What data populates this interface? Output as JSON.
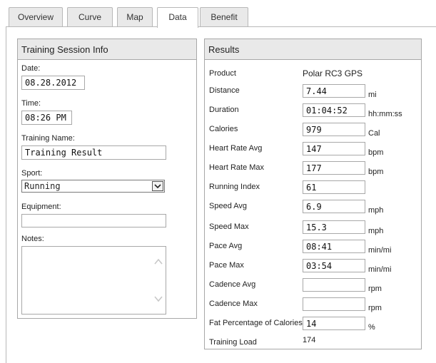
{
  "tabs": [
    {
      "label": "Overview",
      "active": false
    },
    {
      "label": "Curve",
      "active": false
    },
    {
      "label": "Map",
      "active": false
    },
    {
      "label": "Data",
      "active": true
    },
    {
      "label": "Benefit",
      "active": false
    }
  ],
  "session_info": {
    "title": "Training Session Info",
    "date_label": "Date:",
    "date_value": "08.28.2012",
    "time_label": "Time:",
    "time_value": "08:26 PM",
    "training_name_label": "Training Name:",
    "training_name_value": "Training Result",
    "sport_label": "Sport:",
    "sport_value": "Running",
    "equipment_label": "Equipment:",
    "equipment_value": "",
    "notes_label": "Notes:",
    "notes_value": ""
  },
  "results": {
    "title": "Results",
    "product_label": "Product",
    "product_value": "Polar RC3 GPS",
    "rows": [
      {
        "label": "Distance",
        "value": "7.44",
        "unit": "mi"
      },
      {
        "label": "Duration",
        "value": "01:04:52",
        "unit": "hh:mm:ss"
      },
      {
        "label": "Calories",
        "value": "979",
        "unit": "Cal"
      },
      {
        "label": "Heart Rate Avg",
        "value": "147",
        "unit": "bpm"
      },
      {
        "label": "Heart Rate Max",
        "value": "177",
        "unit": "bpm"
      },
      {
        "label": "Running Index",
        "value": "61",
        "unit": ""
      },
      {
        "label": "Speed Avg",
        "value": "6.9",
        "unit": "mph"
      },
      {
        "label": "Speed Max",
        "value": "15.3",
        "unit": "mph"
      },
      {
        "label": "Pace Avg",
        "value": "08:41",
        "unit": "min/mi"
      },
      {
        "label": "Pace Max",
        "value": "03:54",
        "unit": "min/mi"
      },
      {
        "label": "Cadence Avg",
        "value": "",
        "unit": "rpm"
      },
      {
        "label": "Cadence Max",
        "value": "",
        "unit": "rpm"
      },
      {
        "label": "Fat Percentage of Calories",
        "value": "14",
        "unit": "%"
      }
    ],
    "training_load_label": "Training Load",
    "training_load_value": "174"
  },
  "icons": {
    "dropdown": "chevron-down-icon",
    "scroll_up": "chevron-up-icon",
    "scroll_down": "chevron-down-icon"
  }
}
